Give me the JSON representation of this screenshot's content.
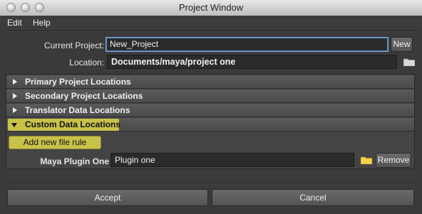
{
  "window": {
    "title": "Project Window"
  },
  "menu": {
    "items": [
      "Edit",
      "Help"
    ]
  },
  "project": {
    "current_label": "Current Project:",
    "current_value": "New_Project",
    "new_button": "New",
    "location_label": "Location:",
    "location_value": "Documents/maya/project one"
  },
  "sections": [
    {
      "label": "Primary Project Locations",
      "expanded": false
    },
    {
      "label": "Secondary Project Locations",
      "expanded": false
    },
    {
      "label": "Translator Data Locations",
      "expanded": false
    },
    {
      "label": "Custom Data Locations",
      "expanded": true
    }
  ],
  "custom": {
    "add_rule_button": "Add new file rule",
    "rule_label": "Maya Plugin One",
    "rule_value": "Plugin one",
    "remove_button": "Remove"
  },
  "footer": {
    "accept": "Accept",
    "cancel": "Cancel"
  },
  "colors": {
    "highlight": "#c9c24a",
    "focus": "#7aa0d4"
  }
}
